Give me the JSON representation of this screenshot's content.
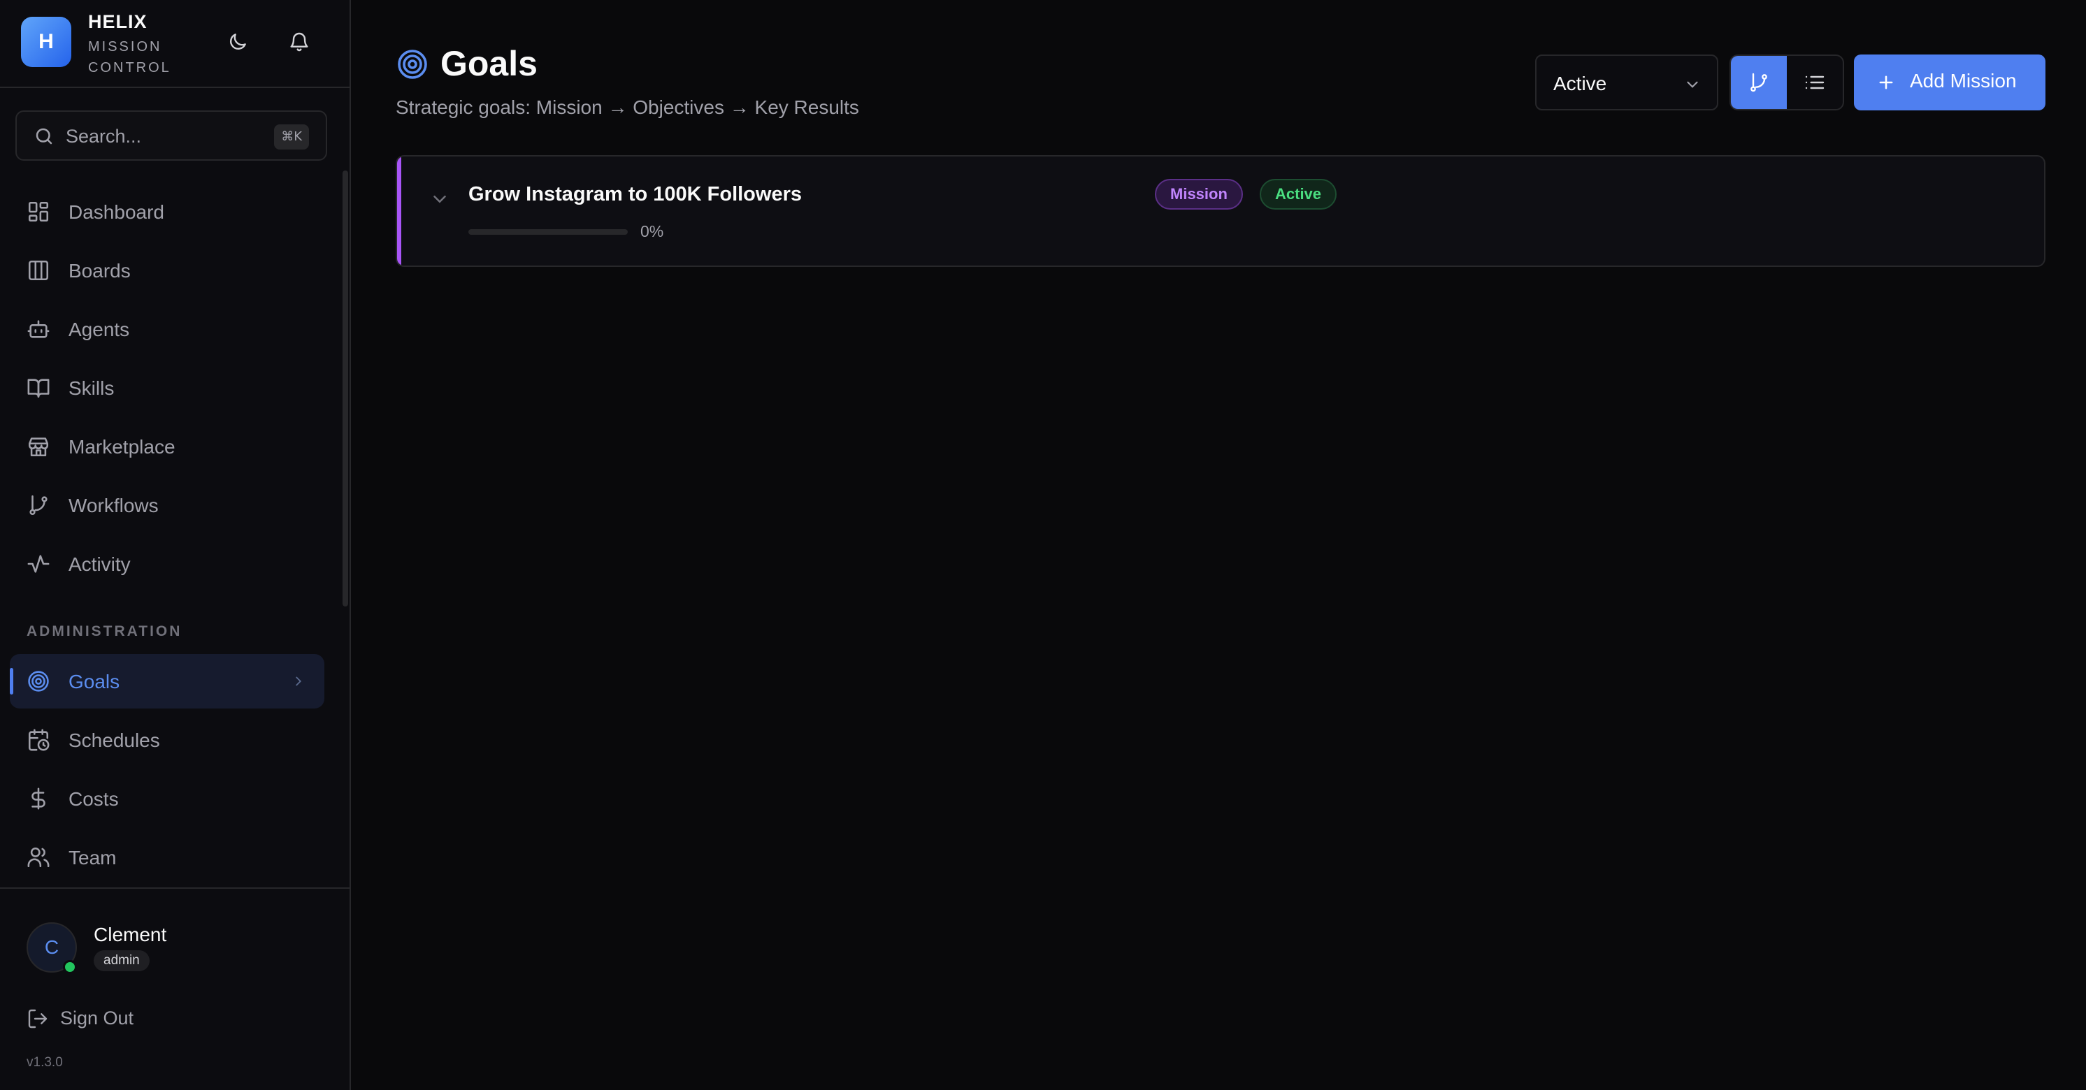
{
  "brand": {
    "logo_letter": "H",
    "name": "HELIX",
    "subtitle": "MISSION CONTROL"
  },
  "search": {
    "placeholder": "Search...",
    "shortcut": "⌘K"
  },
  "sidebar": {
    "items": [
      {
        "label": "Dashboard",
        "icon": "layout-dashboard-icon"
      },
      {
        "label": "Boards",
        "icon": "columns-icon"
      },
      {
        "label": "Agents",
        "icon": "bot-icon"
      },
      {
        "label": "Skills",
        "icon": "book-open-icon"
      },
      {
        "label": "Marketplace",
        "icon": "store-icon"
      },
      {
        "label": "Workflows",
        "icon": "git-branch-icon"
      },
      {
        "label": "Activity",
        "icon": "activity-icon"
      }
    ],
    "admin_title": "ADMINISTRATION",
    "admin_items": [
      {
        "label": "Goals",
        "icon": "target-icon",
        "active": true
      },
      {
        "label": "Schedules",
        "icon": "calendar-clock-icon"
      },
      {
        "label": "Costs",
        "icon": "dollar-icon"
      },
      {
        "label": "Team",
        "icon": "users-icon"
      }
    ]
  },
  "user": {
    "initial": "C",
    "name": "Clement",
    "role": "admin",
    "status": "online"
  },
  "signout_label": "Sign Out",
  "version": "v1.3.0",
  "page": {
    "title": "Goals",
    "subtitle": "Strategic goals: Mission → Objectives → Key Results"
  },
  "toolbar": {
    "filter_value": "Active",
    "view_mode": "tree",
    "add_label": "Add Mission"
  },
  "goals": [
    {
      "title": "Grow Instagram to 100K Followers",
      "type_badge": "Mission",
      "status_badge": "Active",
      "progress": 0,
      "progress_label": "0%"
    }
  ],
  "colors": {
    "accent": "#4f7ff0",
    "mission": "#a855f7",
    "active": "#4ade80",
    "background": "#09090b"
  }
}
